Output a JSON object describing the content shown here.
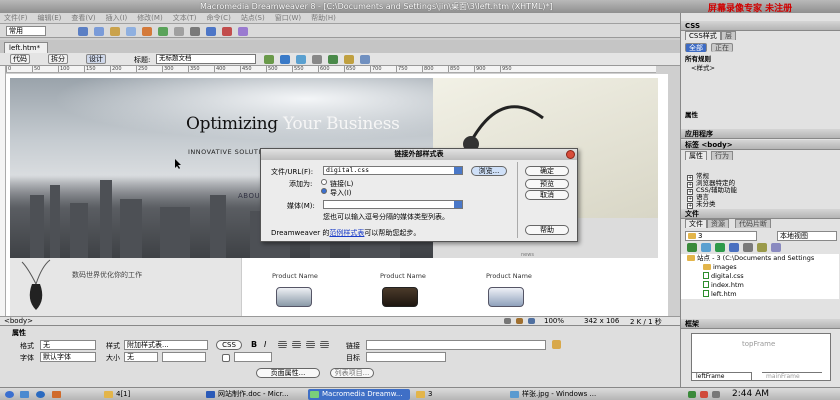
{
  "window": {
    "title": "Macromedia Dreamweaver 8 - [C:\\Documents and Settings\\jin\\桌面\\3\\left.htm (XHTML)*]",
    "watermark": "屏幕录像专家 未注册"
  },
  "menu": [
    "文件(F)",
    "编辑(E)",
    "查看(V)",
    "插入(I)",
    "修改(M)",
    "文本(T)",
    "命令(C)",
    "站点(S)",
    "窗口(W)",
    "帮助(H)"
  ],
  "insertbar": {
    "category": "常用"
  },
  "document": {
    "tab": "left.htm*",
    "views": {
      "code": "代码",
      "split": "拆分",
      "design": "设计"
    },
    "title_label": "标题:",
    "title_value": "无标题文档",
    "ruler_ticks": [
      "0",
      "50",
      "100",
      "150",
      "200",
      "250",
      "300",
      "350",
      "400",
      "450",
      "500",
      "550",
      "600",
      "650",
      "700",
      "750",
      "800",
      "850",
      "900",
      "950"
    ],
    "page": {
      "heading_dark": "Optimizing ",
      "heading_light": "Your Business",
      "subhead": "INNOVATIVE SOLUTIONS",
      "about": "ABOUT",
      "slogan": "数码世界优化你的工作",
      "products": [
        "Product Name",
        "Product Name",
        "Product Name"
      ],
      "news": "news"
    }
  },
  "dialog": {
    "title": "链接外部样式表",
    "file_label": "文件/URL(F):",
    "file_value": "digital.css",
    "browse": "浏览...",
    "addas_label": "添加为:",
    "option_link": "链接(L)",
    "option_import": "导入(I)",
    "media_label": "媒体(M):",
    "media_value": "",
    "hint": "您也可以输入逗号分隔的媒体类型列表。",
    "footer_prefix": "Dreamweaver 的",
    "footer_link": "范例样式表",
    "footer_suffix": "可以帮助您起步。",
    "ok": "确定",
    "preview": "预览",
    "cancel": "取消",
    "help": "帮助"
  },
  "status": {
    "tag": "<body>",
    "zoom": "100%",
    "size": "342 x 106",
    "download": "2 K / 1 秒"
  },
  "properties": {
    "title": "属性",
    "format_label": "格式",
    "format_value": "无",
    "style_label": "样式",
    "style_value": "附加样式表...",
    "css_button": "CSS",
    "bold": "B",
    "italic": "I",
    "link_label": "链接",
    "font_label": "字体",
    "font_value": "默认字体",
    "size_label": "大小",
    "size_value": "无",
    "target_label": "目标",
    "page_props": "页面属性...",
    "list_item": "列表项目..."
  },
  "right_panel": {
    "css_header": "CSS",
    "css_tabs": [
      "CSS样式",
      "层"
    ],
    "css_mode": [
      "全部",
      "正在"
    ],
    "all_rules": "所有规则",
    "rule_style": "<样式>",
    "attrs": "属性",
    "app_header": "应用程序",
    "tag_header": "标签 <body>",
    "tag_tabs": [
      "属性",
      "行为"
    ],
    "tag_rows": [
      "常规",
      "浏览器特定的",
      "CSS/辅助功能",
      "语言",
      "未分类"
    ],
    "files_header": "文件",
    "files_tabs": [
      "文件",
      "资源",
      "代码片断"
    ],
    "site": "3",
    "view": "本地视图",
    "tree_root": "站点 - 3 (C:\\Documents and Settings",
    "tree_items": [
      "images",
      "digital.css",
      "index.htm",
      "left.htm"
    ],
    "frames_header": "框架",
    "frames_top": "topFrame",
    "frames_left": "leftFrame",
    "frames_main": "mainFrame"
  },
  "taskbar": {
    "items": [
      "4[1]",
      "网站制作.doc - Micr...",
      "Macromedia Dreamw...",
      "3",
      "样张.jpg - Windows ..."
    ],
    "clock": "2:44 AM"
  }
}
